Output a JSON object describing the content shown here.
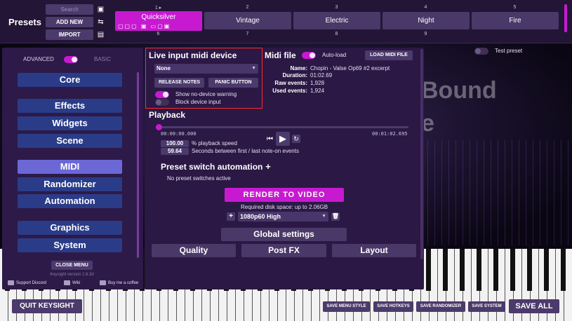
{
  "topbar": {
    "title": "Presets",
    "search_placeholder": "Search",
    "add_new_label": "ADD NEW",
    "import_label": "IMPORT",
    "row1": [
      {
        "num": "1",
        "name": "Quicksilver",
        "active": true
      },
      {
        "num": "2",
        "name": "Vintage"
      },
      {
        "num": "3",
        "name": "Electric"
      },
      {
        "num": "4",
        "name": "Night"
      },
      {
        "num": "5",
        "name": "Fire"
      }
    ],
    "row2_nums": [
      "6",
      "7",
      "8",
      "9"
    ],
    "active_marker": "▸"
  },
  "sidebar": {
    "advanced_label": "ADVANCED",
    "basic_label": "BASIC",
    "items": [
      {
        "label": "Core"
      },
      {
        "label": "Effects"
      },
      {
        "label": "Widgets"
      },
      {
        "label": "Scene"
      },
      {
        "label": "MIDI",
        "active": true
      },
      {
        "label": "Randomizer"
      },
      {
        "label": "Automation"
      },
      {
        "label": "Graphics"
      },
      {
        "label": "System"
      }
    ],
    "close_menu_label": "CLOSE MENU",
    "version": "Keysight version 1.6.3d",
    "links": {
      "discord": "Support Discord",
      "wiki": "Wiki",
      "coffee": "Buy me a coffee"
    }
  },
  "midi_device": {
    "title": "Live input midi device",
    "selected": "None",
    "release_notes_label": "RELEASE NOTES",
    "panic_label": "PANIC BUTTON",
    "show_warning_label": "Show no-device warning",
    "block_input_label": "Block device input"
  },
  "midi_file": {
    "title": "Midi file",
    "autoload_label": "Auto-load",
    "load_button": "LOAD MIDI FILE",
    "name_key": "Name:",
    "name_val": "Chopin - Valse Op69 #2 excerpt",
    "duration_key": "Duration:",
    "duration_val": "01:02.69",
    "raw_key": "Raw events:",
    "raw_val": "1,928",
    "used_key": "Used events:",
    "used_val": "1,924"
  },
  "test_preset_label": "Test preset",
  "playback": {
    "title": "Playback",
    "time_start": "00:00:00.000",
    "time_end": "00:01:02.695",
    "progress": 0.0,
    "speed_value": "100.00",
    "speed_label": "% playback speed",
    "gap_value": "59.64",
    "gap_label": "Seconds between first / last note-on events"
  },
  "automation": {
    "title": "Preset switch automation",
    "empty_text": "No preset switches active"
  },
  "render": {
    "button": "RENDER TO VIDEO",
    "disk_text": "Required disk space: up to 2.06GB",
    "resolution": "1080p60 High"
  },
  "settings": {
    "global": "Global settings",
    "quality": "Quality",
    "postfx": "Post FX",
    "layout": "Layout"
  },
  "bottom": {
    "quit": "QUIT KEYSIGHT",
    "save_menu_style": "SAVE MENU STYLE",
    "save_hotkeys": "SAVE HOTKEYS",
    "save_randomizer": "SAVE RANDOMIZER",
    "save_system": "SAVE SYSTEM",
    "save_all": "SAVE ALL"
  },
  "icons": {
    "plus": "+",
    "trash": "🗑",
    "play": "▶",
    "prev": "⏮",
    "loop": "↻",
    "caret": "▼"
  },
  "colors": {
    "accent": "#c71ad0",
    "nav": "#2a3c88",
    "nav_active": "#6b68d6",
    "warning_outline": "#ff2a2a"
  }
}
